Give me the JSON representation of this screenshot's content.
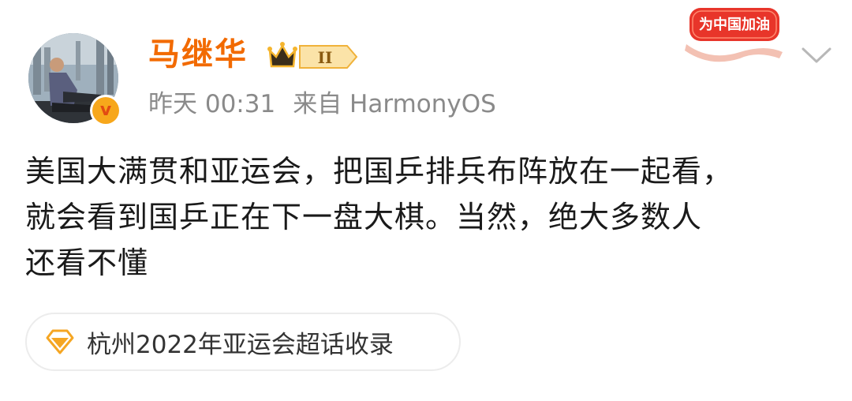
{
  "post": {
    "author": {
      "name": "马继华",
      "avatar_icon": "avatar-photo",
      "verified_icon": "verified-v-icon",
      "verified_letter": "v",
      "vip_level": "II"
    },
    "time": "昨天 00:31",
    "source": "来自 HarmonyOS",
    "campaign_badge": "为中国加油",
    "content_lines": [
      "美国大满贯和亚运会，把国乒排兵布阵放在一起看，",
      "就会看到国乒正在下一盘大棋。当然，绝大多数人",
      "还看不懂"
    ],
    "topic": {
      "icon": "diamond-icon",
      "label": "杭州2022年亚运会超话收录"
    }
  },
  "colors": {
    "username": "#f26a00",
    "meta": "#8a8a8a",
    "badge_red": "#e8352a",
    "vip_gold": "#f5b52e",
    "chip_border": "#ececec"
  }
}
